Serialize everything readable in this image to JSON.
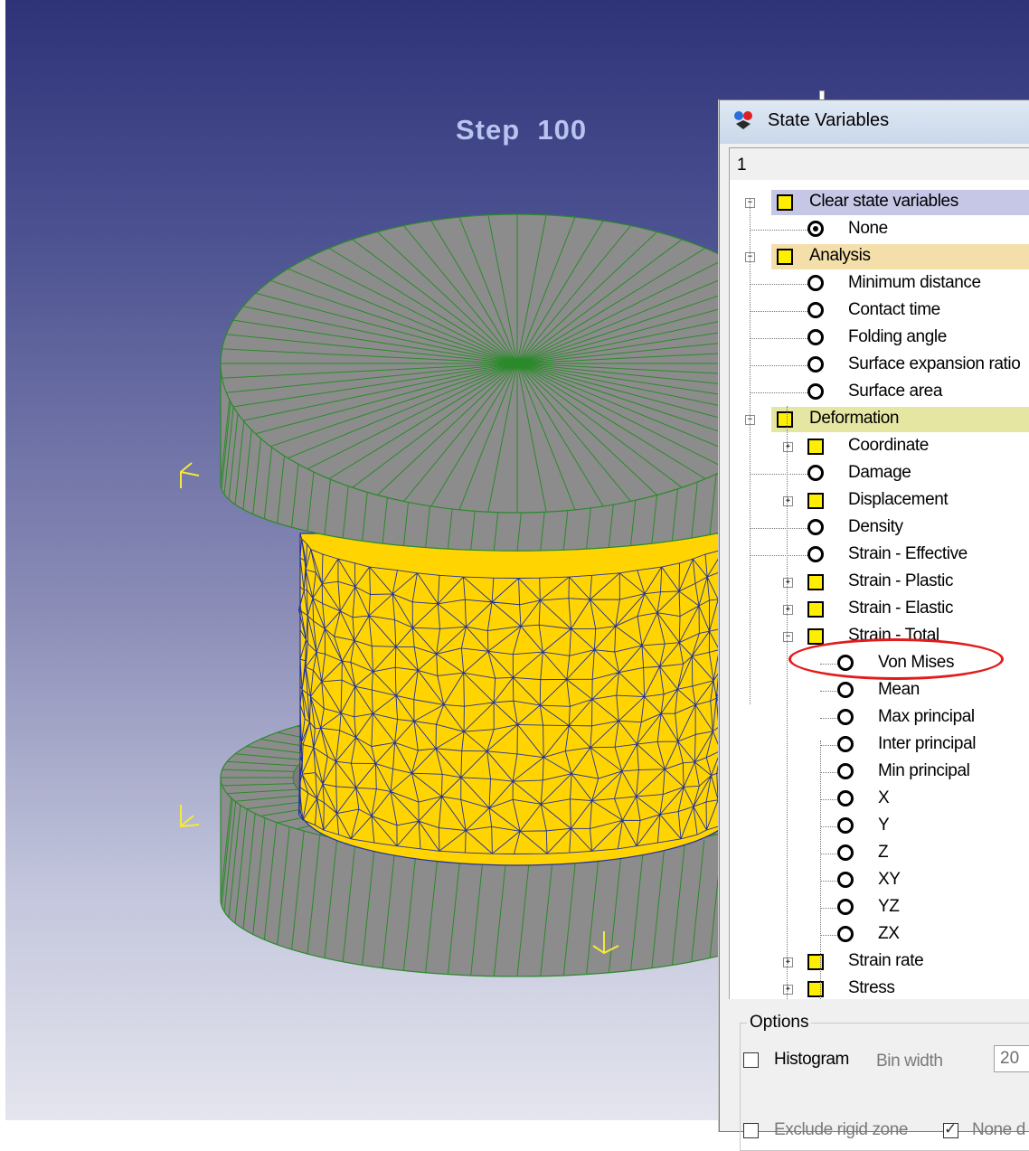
{
  "viewport": {
    "step_label": "Step  100",
    "colors": {
      "die": "#8c8c8c",
      "mesh_line": "#2a8a2a",
      "workpiece": "#ffd400",
      "workpiece_mesh": "#2030a0",
      "axis_marker": "#f5e93a"
    }
  },
  "dialog": {
    "title": "State Variables",
    "tab_label": "1",
    "tree": {
      "categories": [
        {
          "label": "Clear state variables",
          "color": "#c6c6e6",
          "items": [
            {
              "label": "None",
              "type": "radio",
              "selected": true
            }
          ]
        },
        {
          "label": "Analysis",
          "color": "#f4deaa",
          "items": [
            {
              "label": "Minimum distance",
              "type": "radio"
            },
            {
              "label": "Contact time",
              "type": "radio"
            },
            {
              "label": "Folding angle",
              "type": "radio"
            },
            {
              "label": "Surface expansion ratio",
              "type": "radio"
            },
            {
              "label": "Surface area",
              "type": "radio"
            }
          ]
        },
        {
          "label": "Deformation",
          "color": "#e4e6a2",
          "items": [
            {
              "label": "Coordinate",
              "type": "group"
            },
            {
              "label": "Damage",
              "type": "radio"
            },
            {
              "label": "Displacement",
              "type": "group"
            },
            {
              "label": "Density",
              "type": "radio"
            },
            {
              "label": "Strain - Effective",
              "type": "radio"
            },
            {
              "label": "Strain - Plastic",
              "type": "group"
            },
            {
              "label": "Strain - Elastic",
              "type": "group"
            },
            {
              "label": "Strain - Total",
              "type": "group-open",
              "children": [
                "Von Mises",
                "Mean",
                "Max principal",
                "Inter principal",
                "Min principal",
                "X",
                "Y",
                "Z",
                "XY",
                "YZ",
                "ZX"
              ]
            },
            {
              "label": "Strain rate",
              "type": "group"
            },
            {
              "label": "Stress",
              "type": "group"
            }
          ]
        }
      ]
    },
    "options": {
      "title": "Options",
      "histogram_label": "Histogram",
      "histogram_checked": false,
      "bin_width_label": "Bin width",
      "bin_width_value": "20",
      "exclude_rigid_label": "Exclude rigid zone",
      "exclude_rigid_checked": false,
      "none_label": "None d",
      "none_checked": true
    },
    "highlighted_item": "Von Mises"
  }
}
